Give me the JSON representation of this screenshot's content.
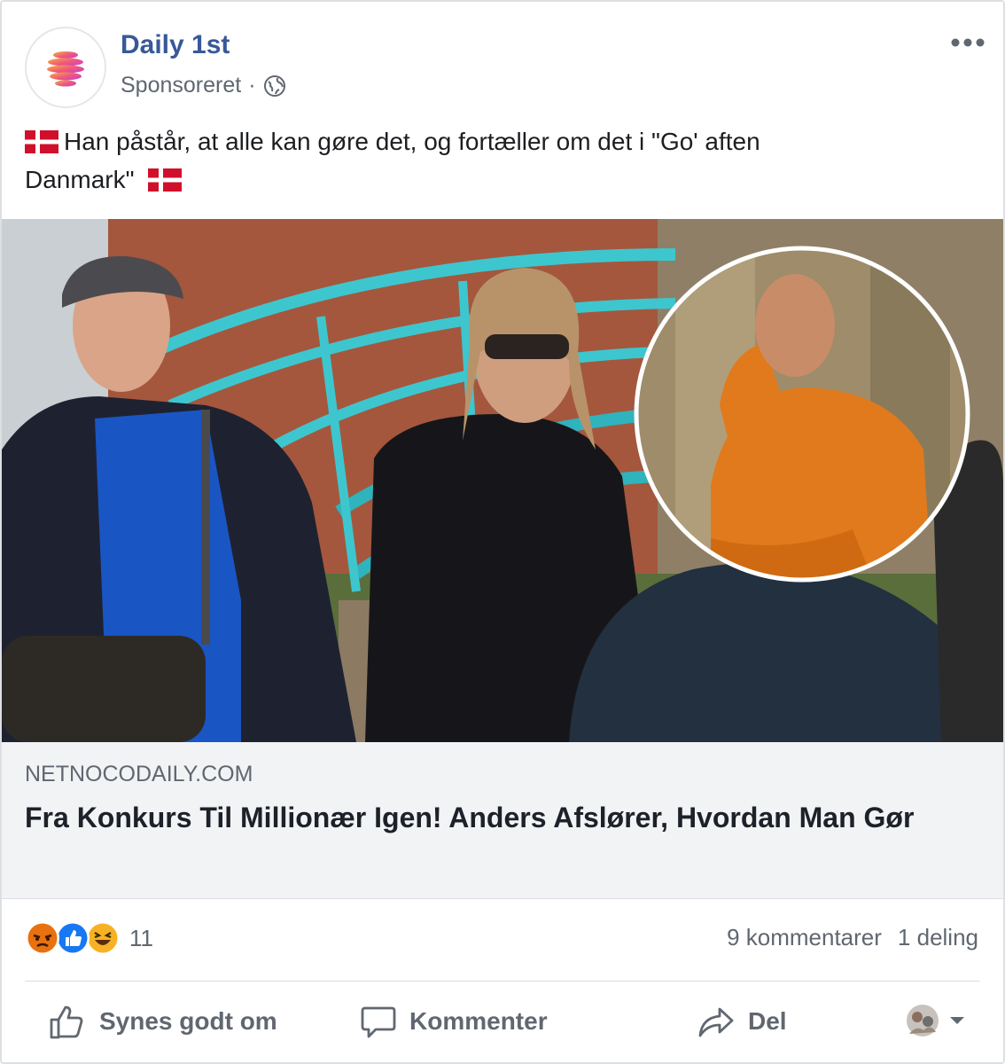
{
  "post": {
    "page_name": "Daily 1st",
    "sponsored": "Sponsoreret",
    "separator": "·",
    "text_line1": "Han påstår, at alle kan gøre det, og fortæller om det i \"Go' aften",
    "text_line2": "Danmark\"",
    "flag_icon": "denmark-flag-icon"
  },
  "link": {
    "domain": "NETNOCODAILY.COM",
    "headline": "Fra Konkurs Til Millionær Igen! Anders Afslører, Hvordan Man Gør"
  },
  "stats": {
    "reaction_icons": [
      "angry-reaction-icon",
      "like-reaction-icon",
      "haha-reaction-icon"
    ],
    "reaction_count": "11",
    "comments": "9 kommentarer",
    "shares": "1 deling"
  },
  "actions": {
    "like": "Synes godt om",
    "comment": "Kommenter",
    "share": "Del"
  },
  "colors": {
    "page_name": "#385898",
    "secondary_text": "#606770",
    "link_bg": "#f2f3f5",
    "like_blue": "#1877f2",
    "angry": "#e9710f",
    "haha": "#f7b125"
  }
}
